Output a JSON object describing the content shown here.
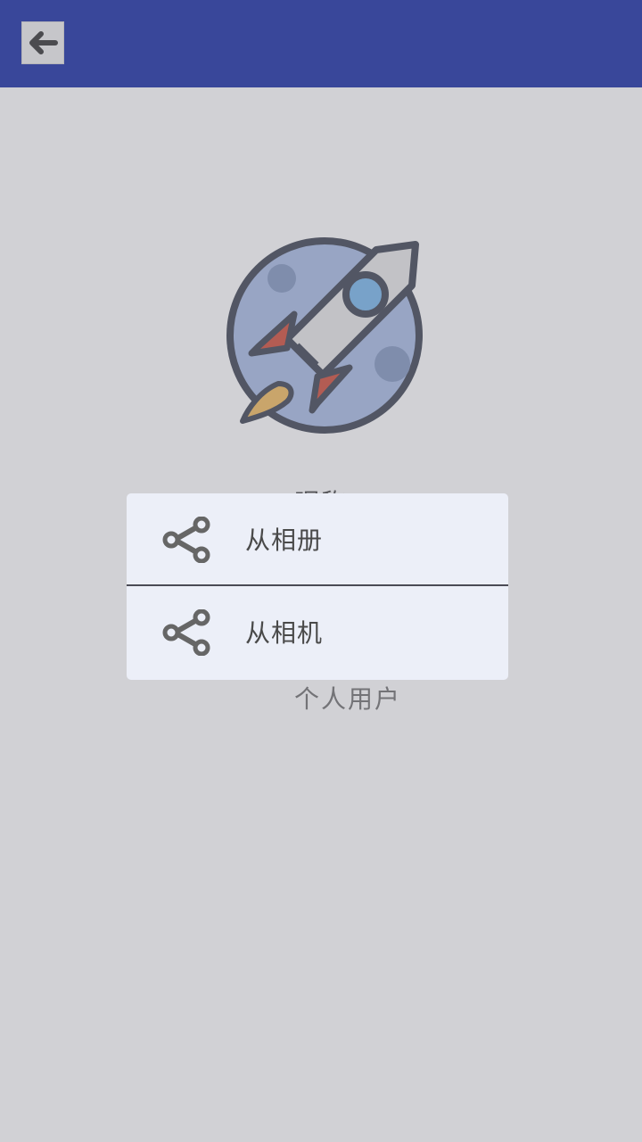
{
  "appbar": {
    "back_icon": "arrow-left-icon",
    "color": "#3f51b5"
  },
  "profile": {
    "avatar_icon": "rocket-icon",
    "hidden_label": "昵称",
    "user_type": "个人用户"
  },
  "photo_dialog": {
    "options": [
      {
        "icon": "share-icon",
        "label": "从相册"
      },
      {
        "icon": "share-icon",
        "label": "从相机"
      }
    ]
  }
}
